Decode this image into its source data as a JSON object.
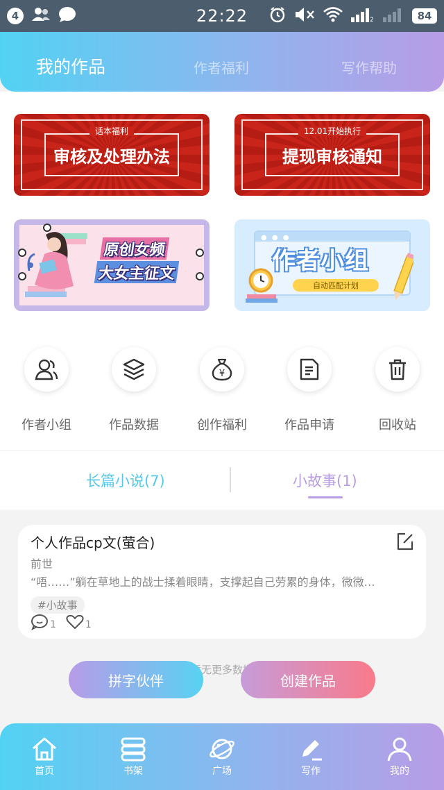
{
  "status_bar": {
    "notification_count": "4",
    "time": "22:22",
    "battery": "84"
  },
  "header": {
    "tabs": [
      {
        "label": "我的作品",
        "active": true
      },
      {
        "label": "作者福利",
        "active": false
      },
      {
        "label": "写作帮助",
        "active": false
      }
    ]
  },
  "banners": {
    "b1": {
      "small": "话本福利",
      "title": "审核及处理办法"
    },
    "b2": {
      "small": "12.01开始执行",
      "title": "提现审核通知"
    },
    "b3": {
      "line1": "原创女频",
      "line2": "大女主征文"
    },
    "b4": {
      "title": "作者小组",
      "pill": "自动匹配计划"
    }
  },
  "quick_actions": [
    {
      "label": "作者小组",
      "icon": "users-icon"
    },
    {
      "label": "作品数据",
      "icon": "layers-icon"
    },
    {
      "label": "创作福利",
      "icon": "money-bag-icon"
    },
    {
      "label": "作品申请",
      "icon": "document-icon"
    },
    {
      "label": "回收站",
      "icon": "trash-icon"
    }
  ],
  "story_tabs": [
    {
      "label": "长篇小说(7)",
      "active": false
    },
    {
      "label": "小故事(1)",
      "active": true
    }
  ],
  "story": {
    "title": "个人作品cp文(萤合)",
    "subtitle": "前世",
    "excerpt": "“唔……”躺在草地上的战士揉着眼睛，支撑起自己劳累的身体，微微…",
    "tag": "#小故事",
    "comments": "1",
    "likes": "1"
  },
  "no_more": "暂无更多数据",
  "buttons": {
    "partner": "拼字伙伴",
    "create": "创建作品"
  },
  "nav": [
    {
      "label": "首页",
      "icon": "home-icon"
    },
    {
      "label": "书架",
      "icon": "bookshelf-icon"
    },
    {
      "label": "广场",
      "icon": "planet-icon"
    },
    {
      "label": "写作",
      "icon": "pen-icon"
    },
    {
      "label": "我的",
      "icon": "profile-icon"
    }
  ],
  "colors": {
    "header_gradient": [
      "#52d2f3",
      "#8fb5ee",
      "#b89ce6"
    ],
    "banner_red": "#c9241a",
    "tab_blue": "#56c8ea",
    "tab_purple": "#b79ce0"
  }
}
